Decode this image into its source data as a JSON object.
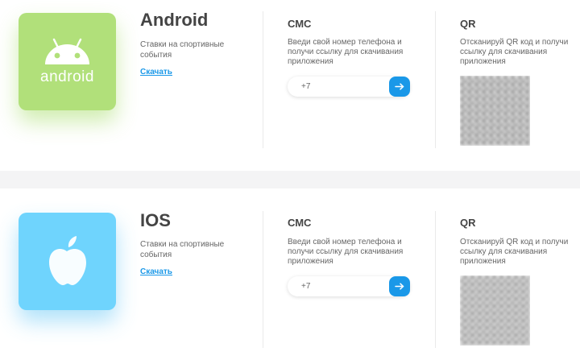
{
  "apps": [
    {
      "title": "Android",
      "logo_text": "android",
      "description": "Ставки на спортивные события",
      "download_label": "Скачать",
      "icon_color": "#b1e07a"
    },
    {
      "title": "IOS",
      "description": "Ставки на спортивные события",
      "download_label": "Скачать",
      "icon_color": "#6fd4fd"
    }
  ],
  "sms": {
    "title": "СМС",
    "description": "Введи свой номер телефона и получи ссылку для скачивания приложения",
    "input_placeholder": "+7",
    "send_icon": "arrow-right-icon",
    "accent_color": "#1a98e8"
  },
  "qr": {
    "title": "QR",
    "description": "Отсканируй QR код и получи ссылку для скачивания приложения"
  }
}
